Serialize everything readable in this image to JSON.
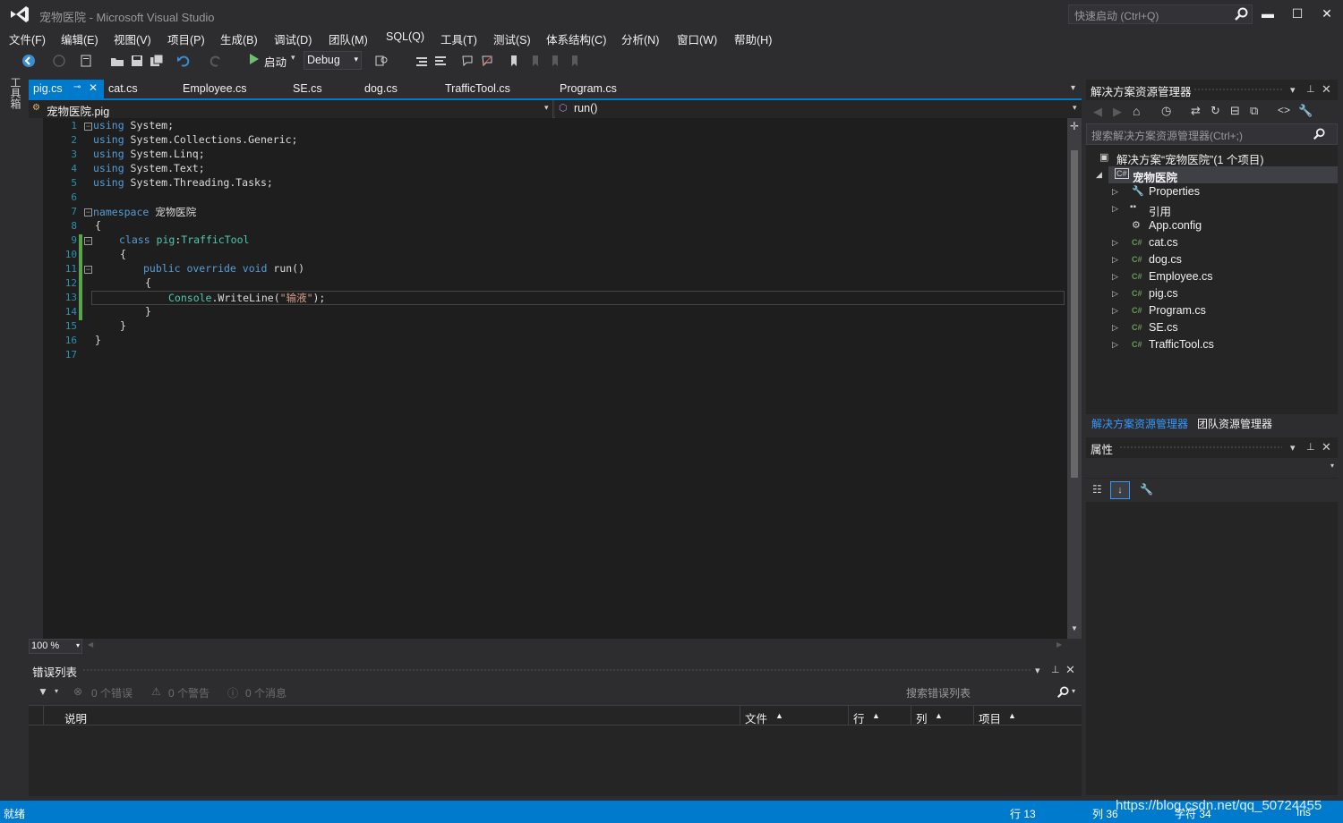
{
  "window": {
    "title": "宠物医院 - Microsoft Visual Studio",
    "quick_launch_placeholder": "快速启动 (Ctrl+Q)",
    "minimize": "▬",
    "maximize": "☐",
    "close": "✕"
  },
  "menu": [
    "文件(F)",
    "编辑(E)",
    "视图(V)",
    "项目(P)",
    "生成(B)",
    "调试(D)",
    "团队(M)",
    "SQL(Q)",
    "工具(T)",
    "测试(S)",
    "体系结构(C)",
    "分析(N)",
    "窗口(W)",
    "帮助(H)"
  ],
  "toolbar": {
    "start_label": "启动",
    "config": "Debug"
  },
  "toolbox_tab": "工具箱",
  "tabs": {
    "active": "pig.cs",
    "others": [
      "cat.cs",
      "Employee.cs",
      "SE.cs",
      "dog.cs",
      "TrafficTool.cs",
      "Program.cs"
    ]
  },
  "navbar": {
    "left": "宠物医院.pig",
    "right": "run()"
  },
  "code": {
    "line_numbers": [
      "1",
      "2",
      "3",
      "4",
      "5",
      "6",
      "7",
      "8",
      "9",
      "10",
      "11",
      "12",
      "13",
      "14",
      "15",
      "16",
      "17"
    ],
    "l1_kw": "using",
    "l1_rest": " System;",
    "l2_kw": "using",
    "l2_rest": " System.Collections.Generic;",
    "l3_kw": "using",
    "l3_rest": " System.Linq;",
    "l4_kw": "using",
    "l4_rest": " System.Text;",
    "l5_kw": "using",
    "l5_rest": " System.Threading.Tasks;",
    "l7_kw": "namespace",
    "l7_rest": " 宠物医院",
    "l8": "{",
    "l9_kw": "class",
    "l9_name": " pig",
    "l9_colon": ":",
    "l9_base": "TrafficTool",
    "l10": "{",
    "l11_kw": "public override void",
    "l11_rest": " run()",
    "l12": "{",
    "l13_type": "Console",
    "l13_mid": ".WriteLine(",
    "l13_str": "\"输液\"",
    "l13_end": ");",
    "l14": "}",
    "l15": "}",
    "l16": "}"
  },
  "zoom": "100 %",
  "error_list": {
    "title": "错误列表",
    "errors": "0 个错误",
    "warnings": "0 个警告",
    "messages": "0 个消息",
    "search_placeholder": "搜索错误列表",
    "columns": [
      "说明",
      "文件",
      "行",
      "列",
      "项目"
    ]
  },
  "solution_explorer": {
    "title": "解决方案资源管理器",
    "search_placeholder": "搜索解决方案资源管理器(Ctrl+;)",
    "solution": "解决方案“宠物医院”(1 个项目)",
    "project": "宠物医院",
    "items": [
      "Properties",
      "引用",
      "App.config",
      "cat.cs",
      "dog.cs",
      "Employee.cs",
      "pig.cs",
      "Program.cs",
      "SE.cs",
      "TrafficTool.cs"
    ],
    "bottom_tabs": [
      "解决方案资源管理器",
      "团队资源管理器"
    ]
  },
  "properties": {
    "title": "属性"
  },
  "status": {
    "ready": "就绪",
    "line": "行 13",
    "col": "列 36",
    "char": "字符 34",
    "ins": "Ins"
  },
  "watermark": "https://blog.csdn.net/qq_50724455",
  "colors": {
    "accent": "#007acc",
    "keyword": "#569cd6",
    "type": "#4ec9b0",
    "string": "#d69d85",
    "line_number": "#2b91af"
  }
}
